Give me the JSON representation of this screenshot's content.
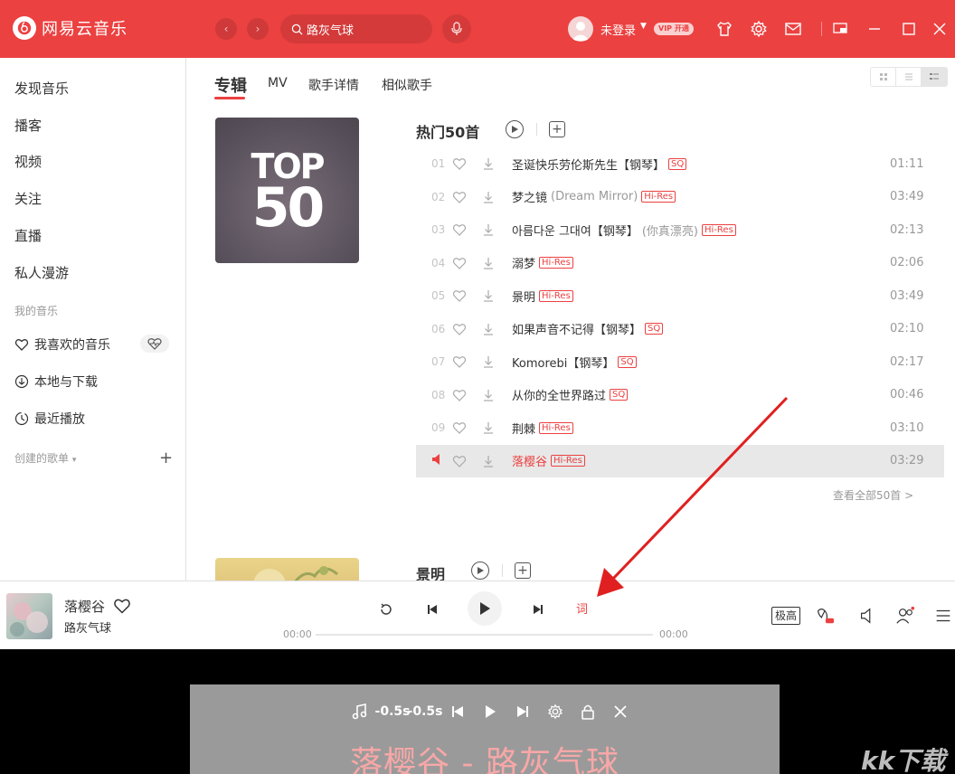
{
  "app": {
    "name": "网易云音乐",
    "search_value": "路灰气球",
    "login_label": "未登录",
    "vip_label": "VIP 开通",
    "colors": {
      "accent": "#ec4141",
      "hires": "#ec4141"
    }
  },
  "sidebar": {
    "items": [
      {
        "label": "发现音乐"
      },
      {
        "label": "播客"
      },
      {
        "label": "视频"
      },
      {
        "label": "关注"
      },
      {
        "label": "直播"
      },
      {
        "label": "私人漫游"
      }
    ],
    "my_music_title": "我的音乐",
    "my_music": [
      {
        "label": "我喜欢的音乐",
        "icon": "heart-icon"
      },
      {
        "label": "本地与下载",
        "icon": "download-icon"
      },
      {
        "label": "最近播放",
        "icon": "history-icon"
      }
    ],
    "created_title": "创建的歌单",
    "created_caret": "▾",
    "add_label": "+"
  },
  "tabs": [
    {
      "label": "专辑",
      "active": true
    },
    {
      "label": "MV"
    },
    {
      "label": "歌手详情"
    },
    {
      "label": "相似歌手"
    }
  ],
  "top50": {
    "cover_line1": "TOP",
    "cover_line2": "50",
    "title": "热门50首",
    "songs": [
      {
        "num": "01",
        "title": "圣诞快乐劳伦斯先生【钢琴】",
        "alias": "",
        "tag": "SQ",
        "duration": "01:11"
      },
      {
        "num": "02",
        "title": "梦之镜",
        "alias": "(Dream Mirror)",
        "tag": "Hi-Res",
        "duration": "03:49"
      },
      {
        "num": "03",
        "title": "아름다운 그대여【钢琴】",
        "alias": "(你真漂亮)",
        "tag": "Hi-Res",
        "duration": "02:13"
      },
      {
        "num": "04",
        "title": "溺梦",
        "alias": "",
        "tag": "Hi-Res",
        "duration": "02:06"
      },
      {
        "num": "05",
        "title": "景明",
        "alias": "",
        "tag": "Hi-Res",
        "duration": "03:49"
      },
      {
        "num": "06",
        "title": "如果声音不记得【钢琴】",
        "alias": "",
        "tag": "SQ",
        "duration": "02:10"
      },
      {
        "num": "07",
        "title": "Komorebi【钢琴】",
        "alias": "",
        "tag": "SQ",
        "duration": "02:17"
      },
      {
        "num": "08",
        "title": "从你的全世界路过",
        "alias": "",
        "tag": "SQ",
        "duration": "00:46"
      },
      {
        "num": "09",
        "title": "荆棘",
        "alias": "",
        "tag": "Hi-Res",
        "duration": "03:10"
      },
      {
        "num": "",
        "title": "落樱谷",
        "alias": "",
        "tag": "Hi-Res",
        "duration": "03:29",
        "playing": true
      }
    ],
    "see_all": "查看全部50首 >"
  },
  "album2": {
    "title": "景明"
  },
  "player": {
    "title": "落樱谷",
    "artist": "路灰气球",
    "time_current": "00:00",
    "time_total": "00:00",
    "progress": 0,
    "lyric_button": "词",
    "quality": "极高"
  },
  "desktop_lyrics": {
    "buttons": [
      "-0.5s",
      "-0.5s"
    ],
    "line": "落樱谷 - 路灰气球"
  },
  "watermark": "kk下载"
}
